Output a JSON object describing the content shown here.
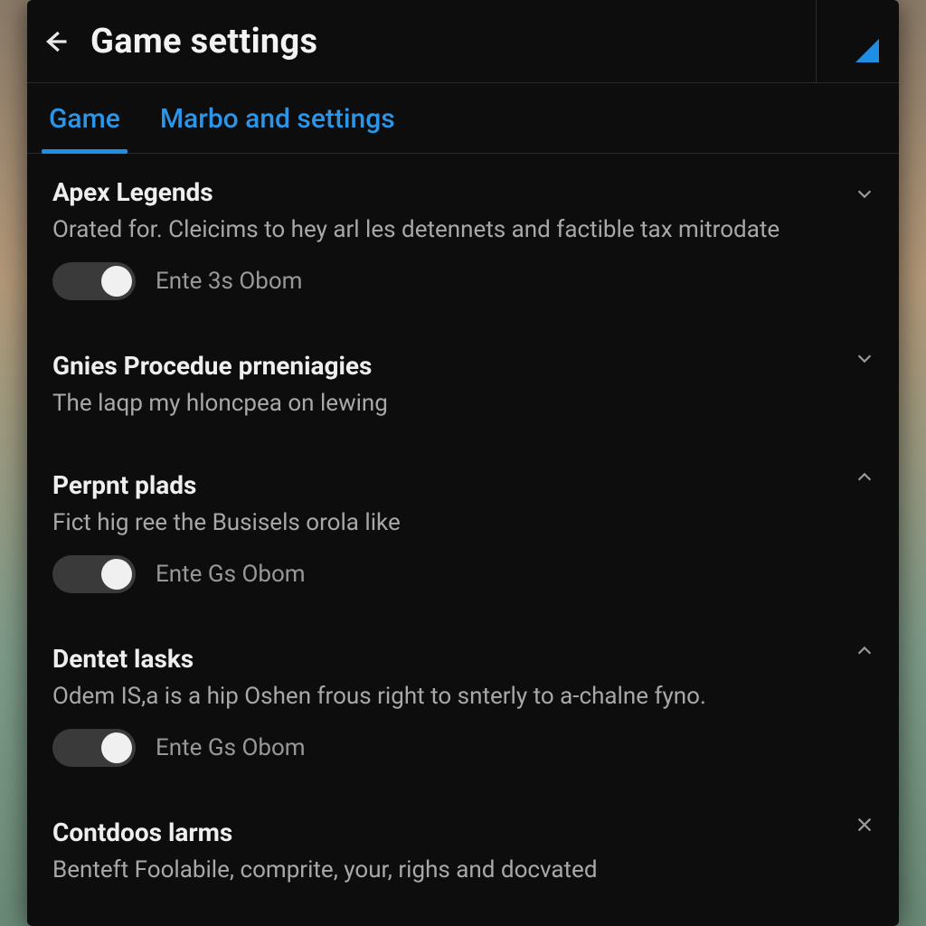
{
  "header": {
    "title": "Game settings"
  },
  "tabs": [
    {
      "label": "Game",
      "active": true
    },
    {
      "label": "Marbo and settings",
      "active": false
    }
  ],
  "sections": [
    {
      "id": "apex",
      "title": "Apex Legends",
      "desc": "Orated for. Cleicims to hey arl les detennets and factible tax mitrodate",
      "chevron": "down",
      "toggle": {
        "state": "on",
        "label": "Ente 3s Obom"
      }
    },
    {
      "id": "gnies",
      "title": "Gnies Procedue prneniagies",
      "desc": "The laqp my hloncpea on lewing",
      "chevron": "down",
      "toggle": null
    },
    {
      "id": "perpnt",
      "title": "Perpnt plads",
      "desc": "Fict hig ree the Busisels orola like",
      "chevron": "up",
      "toggle": {
        "state": "on",
        "label": "Ente Gs Obom"
      }
    },
    {
      "id": "dentet",
      "title": "Dentet lasks",
      "desc": "Odem IS,a is a hip Oshen frous right to snterly to a-chalne fyno.",
      "chevron": "up",
      "toggle": {
        "state": "on",
        "label": "Ente Gs Obom"
      }
    },
    {
      "id": "contdoos",
      "title": "Contdoos larms",
      "desc": "Benteft Foolabile, comprite, your, righs and docvated",
      "chevron": "close",
      "toggle": null
    }
  ],
  "colors": {
    "accent": "#1f8fe6",
    "panel_bg": "#0d0d0d",
    "text_primary": "#eeeeee",
    "text_secondary": "#a8a8a8",
    "toggle_track": "#3a3a3a"
  }
}
